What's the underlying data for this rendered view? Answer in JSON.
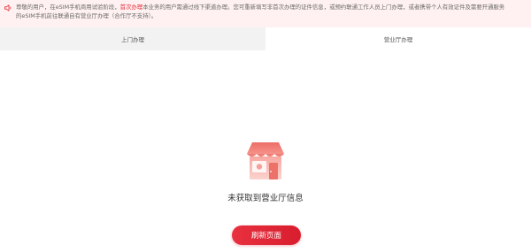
{
  "notice": {
    "icon": "speaker-icon",
    "line1_a": "尊敬的用户，在eSIM手机商用试验阶段，",
    "line1_highlight": "首次办理",
    "line1_b": "本业务的用户需通过线下渠道办理。您可重新填写非首次办理的证件信息，或预约联通工作人员上门办理，或者携带个人有效证件及需要开通服务",
    "line2": "的eSIM手机前往联通自有营业厅办理（合作厅不支持）。",
    "highlight_color": "#e22b36"
  },
  "tabs": [
    {
      "label": "上门办理",
      "active": false
    },
    {
      "label": "营业厅办理",
      "active": true
    }
  ],
  "empty_state": {
    "icon": "store-icon",
    "message": "未获取到营业厅信息",
    "refresh_label": "刷新页面"
  },
  "colors": {
    "accent": "#e22b36",
    "notice_bg": "#fff1f1",
    "tab_inactive_bg": "#f2f2f2"
  }
}
